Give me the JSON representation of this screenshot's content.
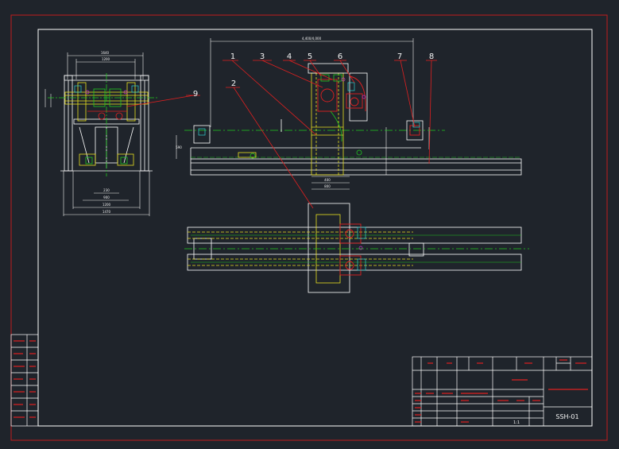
{
  "colors": {
    "background": "#1f242b",
    "frame": "#ffffff",
    "outer_border": "#c01c1c",
    "leader": "#e02020",
    "part_yellow": "#e8e020",
    "center_line": "#20c820",
    "dimension": "#f2f2f2",
    "cyan": "#30d0d0",
    "magenta": "#d030d0"
  },
  "callouts": [
    "1",
    "2",
    "3",
    "4",
    "5",
    "6",
    "7",
    "8",
    "9"
  ],
  "title_block": {
    "drawing_code": "SSH-01",
    "scale": "1:1"
  }
}
